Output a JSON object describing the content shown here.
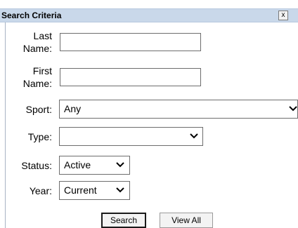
{
  "dialog": {
    "title": "Search Criteria",
    "close_label": "x"
  },
  "form": {
    "last_name": {
      "label_line1": "Last",
      "label_line2": "Name:",
      "value": ""
    },
    "first_name": {
      "label_line1": "First",
      "label_line2": "Name:",
      "value": ""
    },
    "sport": {
      "label": "Sport:",
      "selected": "Any"
    },
    "type": {
      "label": "Type:",
      "selected": ""
    },
    "status": {
      "label": "Status:",
      "selected": "Active"
    },
    "year": {
      "label": "Year:",
      "selected": "Current"
    }
  },
  "buttons": {
    "search_label": "Search",
    "view_all_label": "View All"
  },
  "icons": {
    "dropdown": "chevron-down-icon",
    "close": "close-icon"
  }
}
